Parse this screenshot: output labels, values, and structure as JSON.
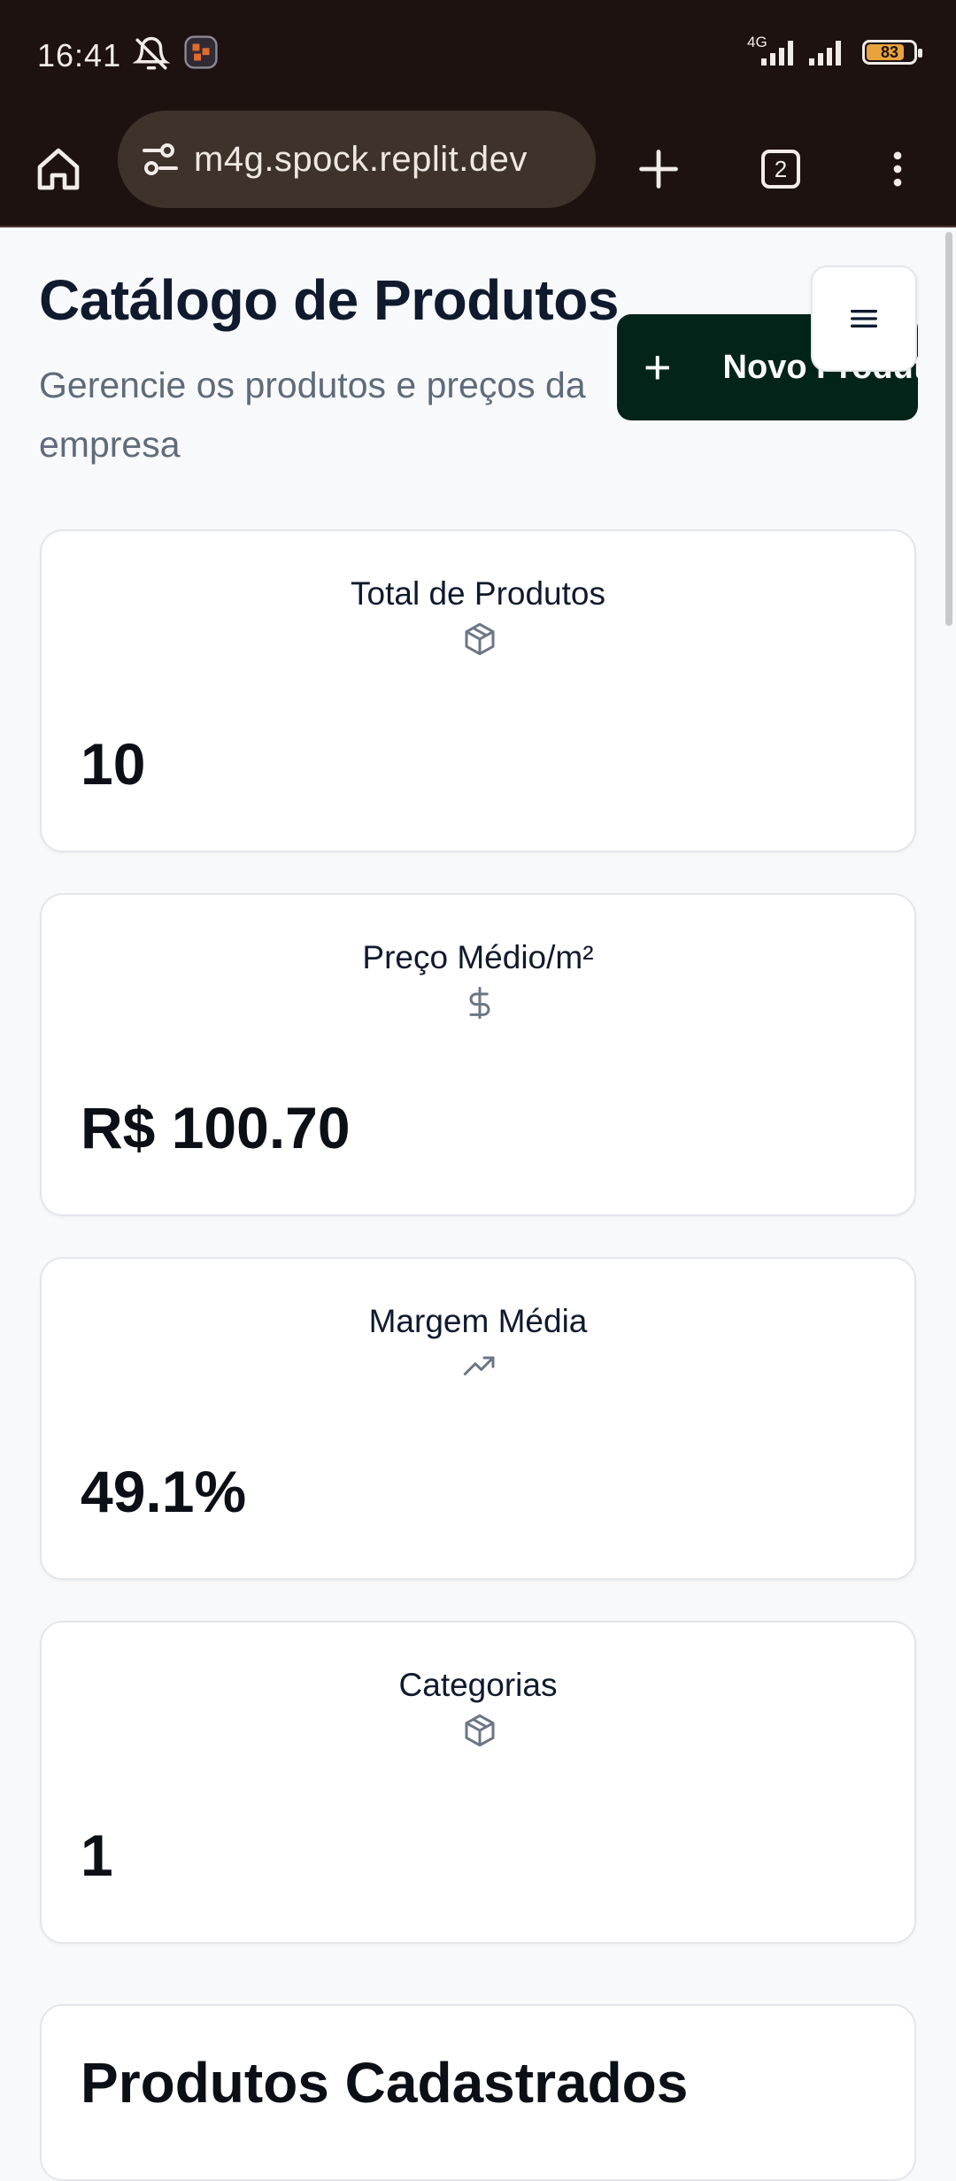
{
  "status_bar": {
    "time": "16:41",
    "network": "4G",
    "battery_percent": "83",
    "icons": [
      "alarm-off-icon",
      "app-notification-icon",
      "signal-icon",
      "battery-icon"
    ]
  },
  "browser": {
    "url": "m4g.spock.replit.dev",
    "tab_count": "2",
    "icons": [
      "home-icon",
      "site-settings-icon",
      "new-tab-icon",
      "tabs-icon",
      "more-vert-icon"
    ]
  },
  "header": {
    "title": "Catálogo de Produtos",
    "subtitle": "Gerencie os produtos e preços da empresa",
    "new_button_label": "Novo Produto",
    "accent_color": "#022419"
  },
  "stats": [
    {
      "title": "Total de Produtos",
      "icon": "package-icon",
      "value": "10"
    },
    {
      "title": "Preço Médio/m²",
      "icon": "dollar-icon",
      "value": "R$ 100.70"
    },
    {
      "title": "Margem Média",
      "icon": "trending-up-icon",
      "value": "49.1%"
    },
    {
      "title": "Categorias",
      "icon": "package-icon",
      "value": "1"
    }
  ],
  "section": {
    "title": "Produtos Cadastrados"
  }
}
